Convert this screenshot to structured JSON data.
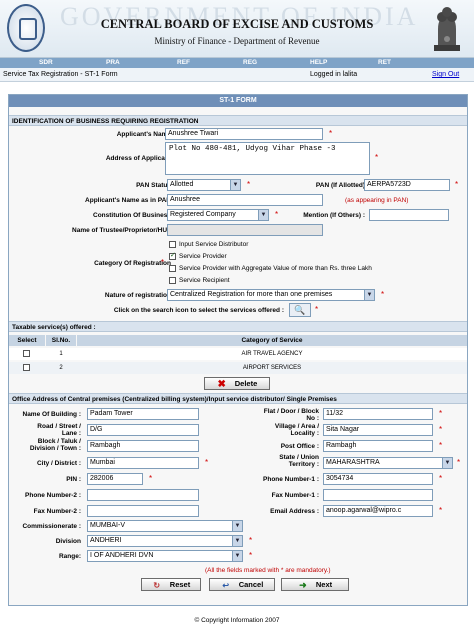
{
  "header": {
    "watermark": "GOVERNMENT OF INDIA",
    "title": "CENTRAL BOARD OF EXCISE AND CUSTOMS",
    "subtitle": "Ministry of Finance - Department of Revenue"
  },
  "nav": [
    "SDR",
    "PRA",
    "REF",
    "REG",
    "HELP",
    "RET"
  ],
  "subnav": {
    "breadcrumb": "Service Tax Registration - ST-1 Form",
    "logged_in": "Logged in lalita",
    "signout": "Sign Out"
  },
  "form": {
    "title": "ST-1 FORM",
    "section1": "IDENTIFICATION OF BUSINESS REQUIRING REGISTRATION",
    "applicant_name_label": "Applicant's Name",
    "applicant_name": "Anushree Tiwari",
    "address_label": "Address of Applicant",
    "address": "Plot No 480-481, Udyog Vihar Phase -3",
    "pan_status_label": "PAN Status",
    "pan_status": "Allotted",
    "pan_allotted_label": "PAN (If Allotted)",
    "pan": "AERPA5723D",
    "pan_name_label": "Applicant's Name as in PAN",
    "pan_name": "Anushree",
    "pan_hint": "(as appearing in PAN)",
    "constitution_label": "Constitution Of Business",
    "constitution": "Registered Company",
    "mention_label": "Mention (If Others) :",
    "trustee_label": "Name of Trustee/Proprietor/HUF",
    "category_label": "Category Of Registration",
    "categories": [
      {
        "label": "Input Service Distributor",
        "checked": false
      },
      {
        "label": "Service Provider",
        "checked": true
      },
      {
        "label": "Service Provider with Aggregate Value of more than Rs. three Lakh",
        "checked": false
      },
      {
        "label": "Service Recipient",
        "checked": false
      }
    ],
    "nature_label": "Nature of registration",
    "nature": "Centralized Registration for more than one premises",
    "search_label": "Click on the search icon to select the services offered :",
    "taxable_label": "Taxable service(s) offered :",
    "table_headers": [
      "Select",
      "Sl.No.",
      "Category of Service"
    ],
    "table_rows": [
      {
        "slno": "1",
        "service": "AIR TRAVEL AGENCY"
      },
      {
        "slno": "2",
        "service": "AIRPORT SERVICES"
      }
    ],
    "delete_label": "Delete",
    "section2": "Office Address of Central premises (Centralized billing system)/Input service distributor/ Single Premises",
    "building_label": "Name Of Building :",
    "building": "Padam Tower",
    "flat_label": "Flat / Door / Block No :",
    "flat": "11/32",
    "road_label": "Road / Street / Lane :",
    "road": "D/G",
    "village_label": "Village / Area / Locality :",
    "village": "Sita Nagar",
    "block_label": "Block / Taluk / Division / Town :",
    "block": "Rambagh",
    "post_label": "Post Office :",
    "post": "Rambagh",
    "city_label": "City / District :",
    "city": "Mumbai",
    "state_label": "State / Union Territory :",
    "state": "MAHARASHTRA",
    "pin_label": "PIN :",
    "pin": "282006",
    "phone1_label": "Phone Number-1 :",
    "phone1": "3054734",
    "phone2_label": "Phone Number-2 :",
    "fax1_label": "Fax Number-1 :",
    "fax2_label": "Fax Number-2 :",
    "email_label": "Email Address :",
    "email": "anoop.agarwal@wipro.c",
    "commissionerate_label": "Commissionerate :",
    "commissionerate": "MUMBAI-V",
    "division_label": "Division",
    "division": "ANDHERI",
    "range_label": "Range:",
    "range": "I OF ANDHERI DVN",
    "mandatory_note": "(All the fields marked with * are mandatory.)",
    "reset": "Reset",
    "cancel": "Cancel",
    "next": "Next"
  },
  "footer": "© Copyright Information 2007"
}
